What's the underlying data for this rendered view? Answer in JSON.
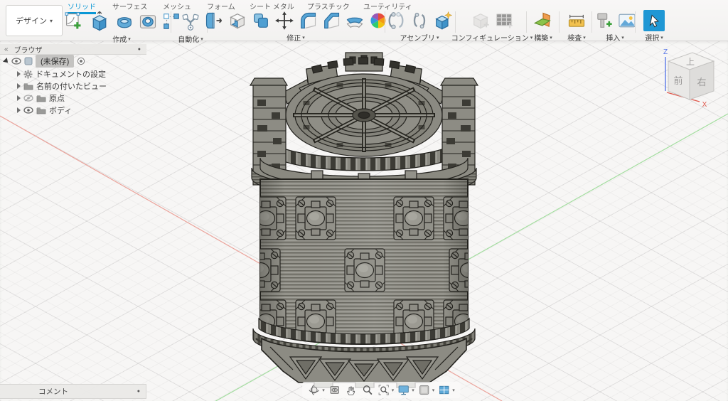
{
  "design_menu": {
    "label": "デザイン"
  },
  "tabs": [
    {
      "label": "ソリッド",
      "active": true
    },
    {
      "label": "サーフェス",
      "active": false
    },
    {
      "label": "メッシュ",
      "active": false
    },
    {
      "label": "フォーム",
      "active": false
    },
    {
      "label": "シート メタル",
      "active": false
    },
    {
      "label": "プラスチック",
      "active": false
    },
    {
      "label": "ユーティリティ",
      "active": false
    }
  ],
  "toolbar_groups": [
    {
      "label": "作成"
    },
    {
      "label": "自動化"
    },
    {
      "label": "修正"
    },
    {
      "label": "アセンブリ"
    },
    {
      "label": "コンフィギュレーション"
    },
    {
      "label": "構築"
    },
    {
      "label": "検査"
    },
    {
      "label": "挿入"
    },
    {
      "label": "選択"
    }
  ],
  "browser": {
    "title": "ブラウザ",
    "root_label": "(未保存)",
    "items": [
      {
        "label": "ドキュメントの設定"
      },
      {
        "label": "名前の付いたビュー"
      },
      {
        "label": "原点"
      },
      {
        "label": "ボディ"
      }
    ]
  },
  "viewcube": {
    "top_face": "上",
    "front_face": "前",
    "right_face": "右",
    "z_axis": "Z",
    "x_axis": "X"
  },
  "comment_bar": {
    "label": "コメント"
  },
  "icons": {
    "caret": "▾",
    "collapse": "«",
    "dot": "●"
  },
  "colors": {
    "accent_blue": "#0a97d5",
    "axis_x_red": "#e2887f",
    "axis_y_green": "#94d88f",
    "model_gray": "#8d8c84",
    "select_active_blue": "#1f97d4"
  }
}
